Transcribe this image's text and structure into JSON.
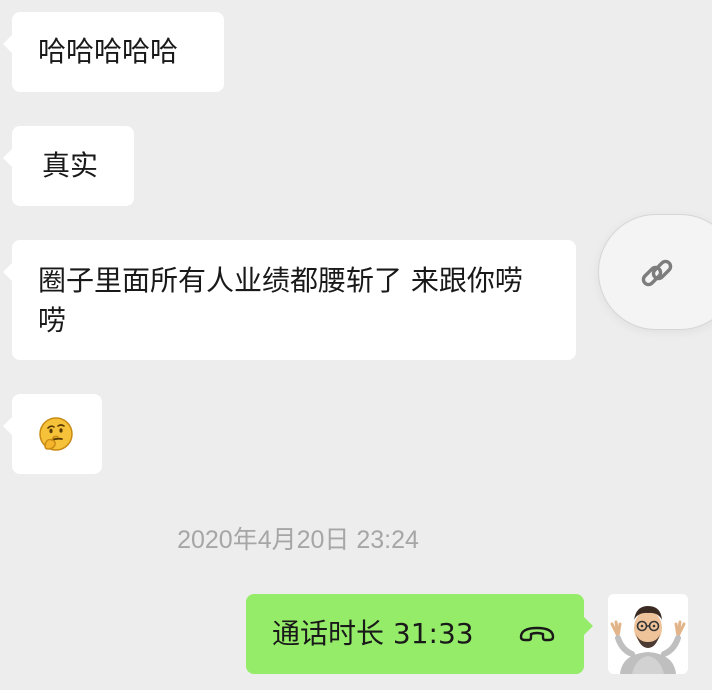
{
  "messages": [
    {
      "text": "哈哈哈哈哈"
    },
    {
      "text": "真实"
    },
    {
      "text": "圈子里面所有人业绩都腰斩了  来跟你唠唠"
    },
    {
      "emoji": "thinking-face-emoji"
    }
  ],
  "timestamp": "2020年4月20日 23:24",
  "call": {
    "label": "通话时长 31:33",
    "icon": "phone-hangup-icon"
  },
  "link_button": {
    "icon": "link-icon"
  },
  "avatar": {
    "icon": "memoji-avatar"
  },
  "colors": {
    "background": "#ededed",
    "incoming_bubble": "#ffffff",
    "outgoing_bubble": "#95ec69",
    "timestamp_text": "#a6a6a6",
    "icon_gray": "#7d7d7d"
  }
}
